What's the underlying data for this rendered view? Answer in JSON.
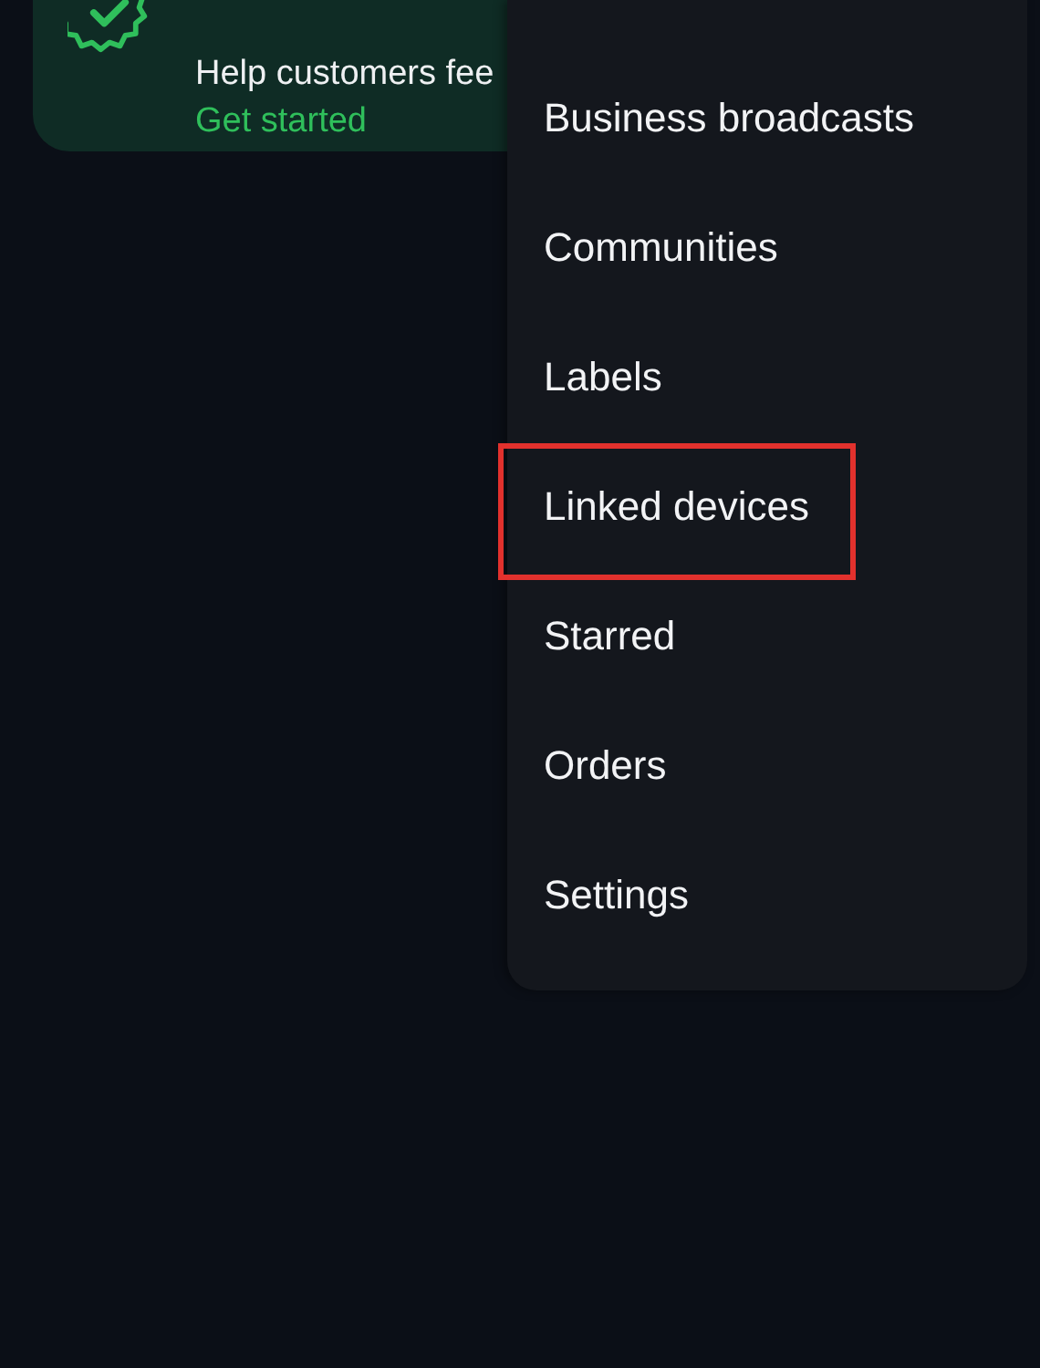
{
  "banner": {
    "text": "Help customers fee",
    "link": "Get started"
  },
  "menu": {
    "items": [
      {
        "label": "Business broadcasts",
        "highlighted": false
      },
      {
        "label": "Communities",
        "highlighted": false
      },
      {
        "label": "Labels",
        "highlighted": false
      },
      {
        "label": "Linked devices",
        "highlighted": true
      },
      {
        "label": "Starred",
        "highlighted": false
      },
      {
        "label": "Orders",
        "highlighted": false
      },
      {
        "label": "Settings",
        "highlighted": false
      }
    ]
  }
}
